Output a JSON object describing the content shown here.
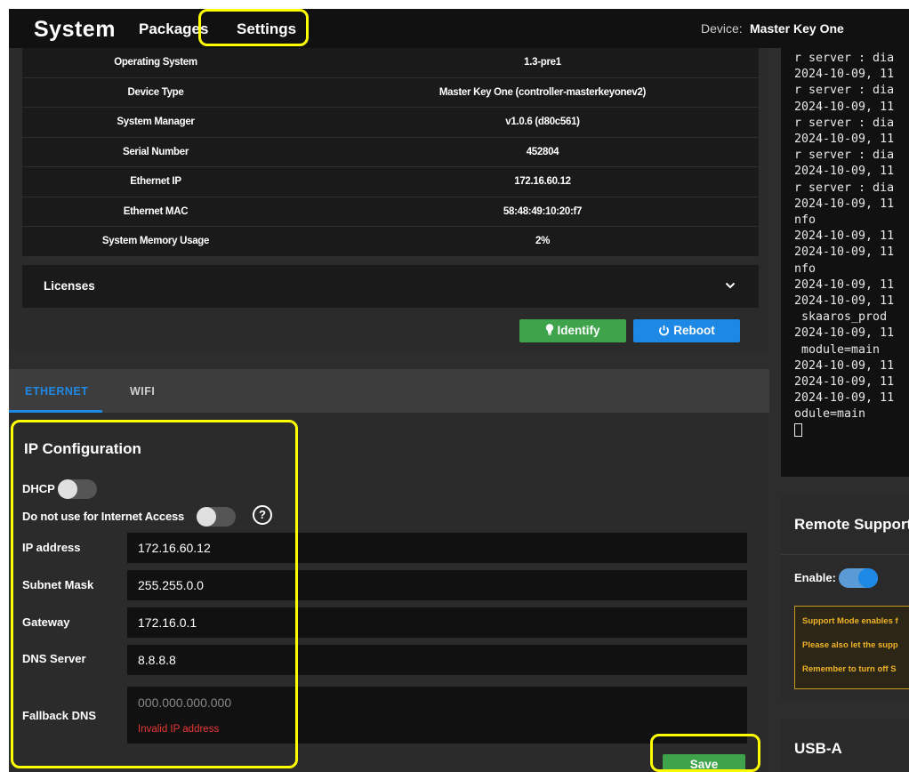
{
  "topbar": {
    "brand": "System",
    "tabs": [
      {
        "label": "Packages"
      },
      {
        "label": "Settings"
      }
    ],
    "device_label": "Device:",
    "device_name": "Master Key One"
  },
  "info": {
    "rows": [
      {
        "key": "Operating System",
        "value": "1.3-pre1"
      },
      {
        "key": "Device Type",
        "value": "Master Key One (controller-masterkeyonev2)"
      },
      {
        "key": "System Manager",
        "value": "v1.0.6 (d80c561)"
      },
      {
        "key": "Serial Number",
        "value": "452804"
      },
      {
        "key": "Ethernet IP",
        "value": "172.16.60.12"
      },
      {
        "key": "Ethernet MAC",
        "value": "58:48:49:10:20:f7"
      },
      {
        "key": "System Memory Usage",
        "value": "2%"
      }
    ],
    "licenses_label": "Licenses",
    "identify_label": "Identify",
    "reboot_label": "Reboot"
  },
  "console": {
    "text": "r server : dia\n2024-10-09, 11\nr server : dia\n2024-10-09, 11\nr server : dia\n2024-10-09, 11\nr server : dia\n2024-10-09, 11\nr server : dia\n2024-10-09, 11\nnfo\n2024-10-09, 11\n2024-10-09, 11\nnfo\n2024-10-09, 11\n2024-10-09, 11\n skaaros_prod\n2024-10-09, 11\n module=main\n2024-10-09, 11\n2024-10-09, 11\n2024-10-09, 11\nodule=main"
  },
  "remote_support": {
    "title": "Remote Support",
    "enable_label": "Enable:",
    "enabled": true,
    "warning_lines": [
      "Support Mode enables f",
      "Please also let the supp",
      "Remember to turn off S"
    ],
    "warning_color": "#f0b324"
  },
  "usb": {
    "title": "USB-A"
  },
  "network": {
    "tabs": [
      {
        "label": "ETHERNET",
        "active": true
      },
      {
        "label": "WIFI",
        "active": false
      }
    ],
    "section_title": "IP Configuration",
    "dhcp_label": "DHCP",
    "dhcp_enabled": false,
    "no_internet_label": "Do not use for Internet Access",
    "no_internet_enabled": false,
    "help_glyph": "?",
    "fields": {
      "ip_address": {
        "label": "IP address",
        "value": "172.16.60.12"
      },
      "subnet_mask": {
        "label": "Subnet Mask",
        "value": "255.255.0.0"
      },
      "gateway": {
        "label": "Gateway",
        "value": "172.16.0.1"
      },
      "dns_server": {
        "label": "DNS Server",
        "value": "8.8.8.8"
      },
      "fallback_dns": {
        "label": "Fallback DNS",
        "value": "",
        "placeholder": "000.000.000.000",
        "error": "Invalid IP address"
      }
    },
    "save_label": "Save"
  },
  "colors": {
    "accent_blue": "#1e88e5",
    "green": "#3ea34b",
    "highlight": "#ffff00",
    "error_red": "#e53935"
  }
}
